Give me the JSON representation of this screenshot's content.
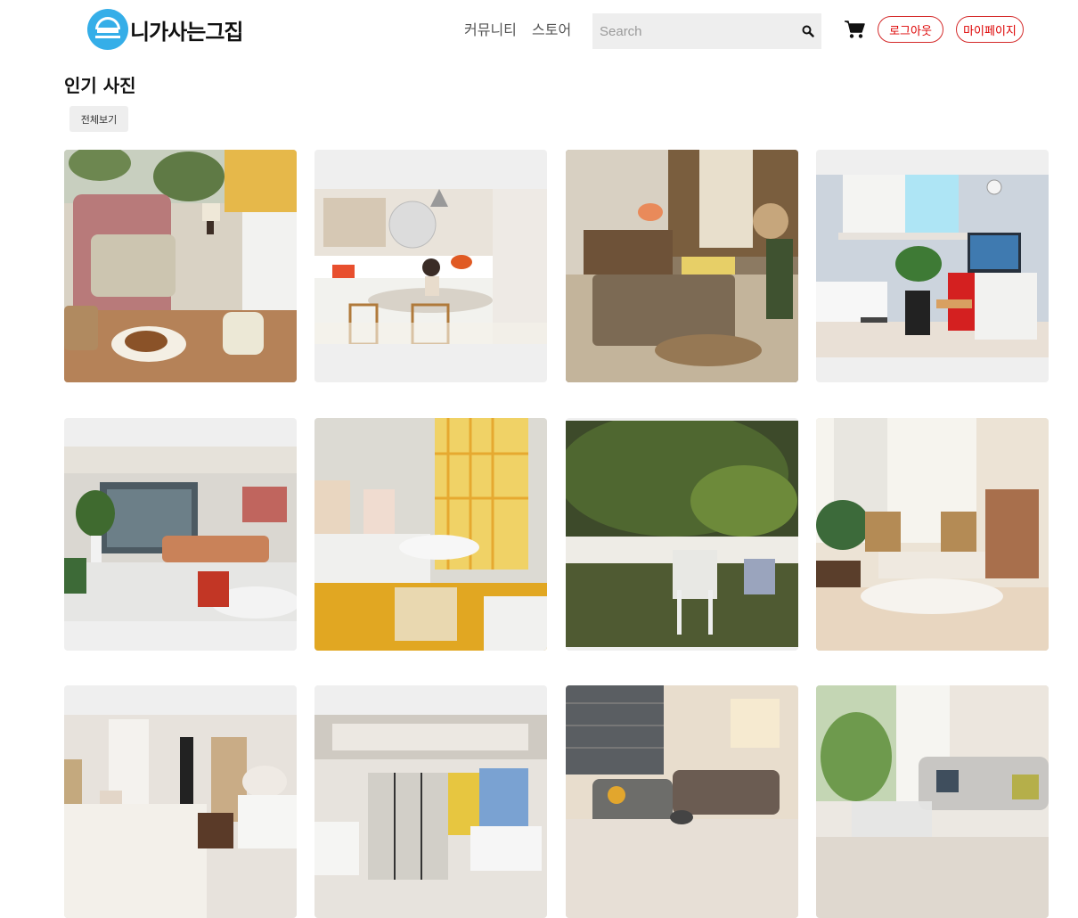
{
  "header": {
    "logo_text": "니가사는그집",
    "nav": [
      "커뮤니티",
      "스토어"
    ],
    "search_placeholder": "Search",
    "buttons": {
      "logout": "로그아웃",
      "mypage": "마이페이지"
    }
  },
  "section": {
    "title": "인기 사진",
    "filter_chip": "전체보기"
  },
  "colors": {
    "accent_red": "#d42a2a",
    "logo_blue": "#35aee8",
    "placeholder_bg": "#efefef"
  },
  "photos": [
    {
      "alt": "living chair with coffee table"
    },
    {
      "alt": "white kitchen with child"
    },
    {
      "alt": "bedroom with fairy lights"
    },
    {
      "alt": "room with red cabinet and TV"
    },
    {
      "alt": "living room with sofa"
    },
    {
      "alt": "room with yellow curtains"
    },
    {
      "alt": "garden with white fence"
    },
    {
      "alt": "bright living room with chairs"
    },
    {
      "alt": "bedroom with mirror"
    },
    {
      "alt": "room with glass partition"
    },
    {
      "alt": "room with sofa and string lights"
    },
    {
      "alt": "living room with grey sofa"
    }
  ]
}
